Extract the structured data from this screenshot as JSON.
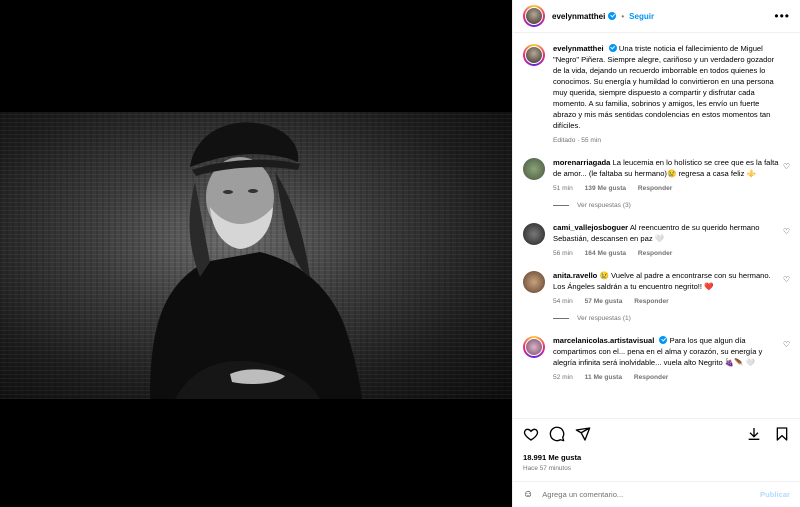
{
  "header": {
    "username": "evelynmatthei",
    "separator": "•",
    "follow_label": "Seguir",
    "more_icon": "more-horizontal-icon"
  },
  "caption": {
    "username": "evelynmatthei",
    "text": "Una triste noticia el fallecimiento de Miguel \"Negro\" Piñera. Siempre alegre, cariñoso y un verdadero gozador de la vida, dejando un recuerdo imborrable en todos quienes lo conocimos. Su energía y humildad lo convirtieron en una persona muy querida, siempre dispuesto a compartir y disfrutar cada momento. A su familia, sobrinos y amigos, les envío un fuerte abrazo y mis más sentidas condolencias en estos momentos tan difíciles.",
    "edited": "Editado · 55 min"
  },
  "comments": [
    {
      "username": "morenarriagada",
      "text": "La leucemia en lo holístico se cree que es la falta de amor... (le faltaba su hermano)😢 regresa a casa feliz ⚜️",
      "time": "51 min",
      "likes": "139 Me gusta",
      "reply": "Responder",
      "view_replies": "Ver respuestas (3)"
    },
    {
      "username": "cami_vallejosboguer",
      "text": "Al reencuentro de su querido hermano Sebastián, descansen en paz 🤍",
      "time": "56 min",
      "likes": "164 Me gusta",
      "reply": "Responder"
    },
    {
      "username": "anita.ravello",
      "text": "😢 Vuelve al padre a encontrarse con su hermano. Los Ángeles saldrán a tu encuentro negrito!! ❤️",
      "time": "54 min",
      "likes": "57 Me gusta",
      "reply": "Responder",
      "view_replies": "Ver respuestas (1)"
    },
    {
      "username": "marcelanicolas.artistavisual",
      "text": "Para los que algun día compartimos con el... pena en el alma y corazón, su energía y alegría infinita será inolvidable... vuela alto Negrito 🍇🪶 🤍",
      "time": "52 min",
      "likes": "11 Me gusta",
      "reply": "Responder"
    }
  ],
  "actions": {
    "likes": "18.991 Me gusta",
    "time_ago": "Hace 57 minutos"
  },
  "comment_box": {
    "placeholder": "Agrega un comentario...",
    "publish_label": "Publicar"
  },
  "colors": {
    "accent": "#0095f6",
    "muted": "#737373"
  }
}
